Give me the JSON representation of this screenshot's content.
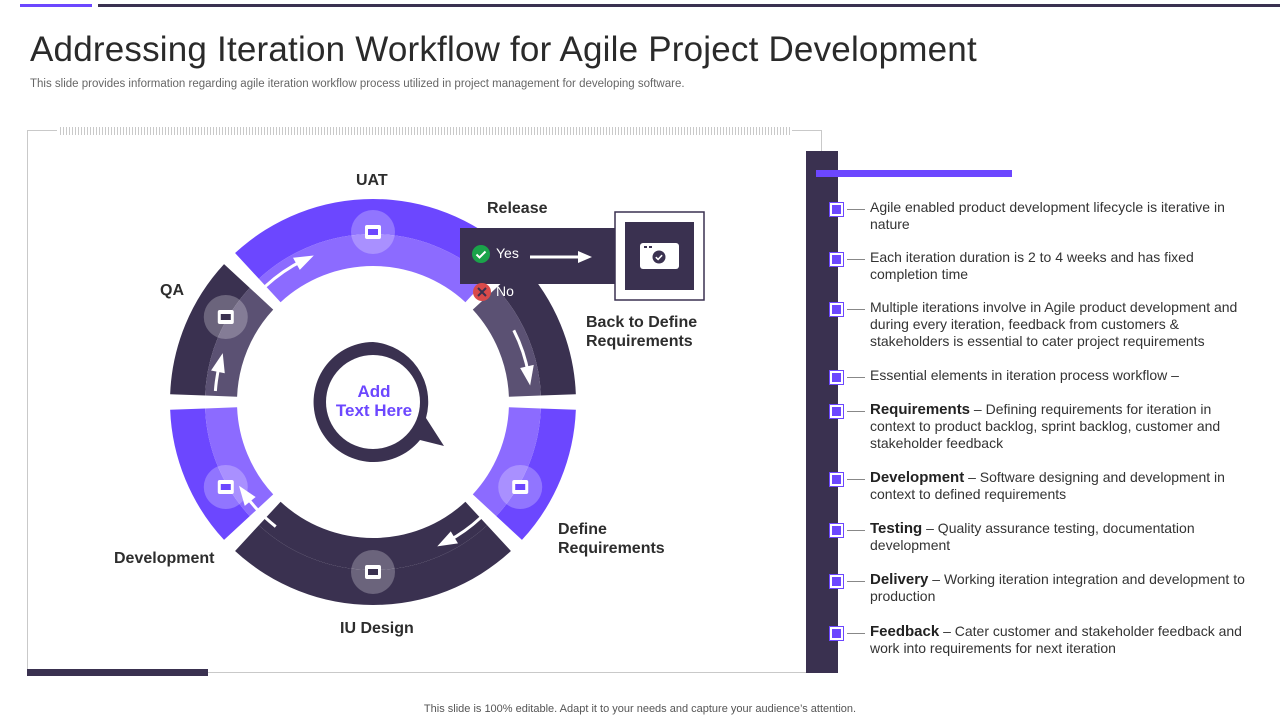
{
  "title": "Addressing Iteration Workflow for Agile Project Development",
  "subtitle": "This slide provides information regarding agile iteration workflow process utilized in project management for developing software.",
  "footer": "This slide is 100% editable. Adapt it to your needs and capture your audience’s attention.",
  "colors": {
    "accent": "#6c47ff",
    "dark": "#3a3150",
    "ring_mid": "#5b5173",
    "no": "#d94a4a",
    "yes": "#1aa34a"
  },
  "diagram": {
    "stages": {
      "uat": "UAT",
      "release": "Release",
      "qa": "QA",
      "development": "Development",
      "iu_design": "IU Design",
      "define_requirements": [
        "Define",
        "Requirements"
      ],
      "back_to_define": [
        "Back to Define",
        "Requirements"
      ]
    },
    "decision": {
      "yes": "Yes",
      "no": "No"
    },
    "center_text": [
      "Add",
      "Text Here"
    ],
    "icons": [
      "thumbs-up-icon",
      "code-window-icon",
      "clipboard-search-icon",
      "monitor-icon",
      "code-window-search-icon",
      "camera-icon"
    ]
  },
  "bullets": [
    {
      "text": "Agile enabled product development lifecycle is iterative in nature"
    },
    {
      "text": "Each iteration duration is 2 to 4 weeks and has fixed completion time"
    },
    {
      "text": "Multiple iterations involve in Agile product development and during every iteration, feedback from customers & stakeholders is essential to cater project requirements"
    },
    {
      "text": "Essential elements in iteration process workflow –"
    },
    {
      "bold": "Requirements",
      "text": " – Defining requirements for iteration in context to product backlog, sprint backlog, customer and stakeholder feedback"
    },
    {
      "bold": "Development",
      "text": " – Software designing and development in context to defined requirements"
    },
    {
      "bold": "Testing",
      "text": " – Quality assurance testing, documentation development"
    },
    {
      "bold": "Delivery",
      "text": " – Working iteration integration and development to production"
    },
    {
      "bold": "Feedback",
      "text": " – Cater customer and stakeholder feedback and work into requirements for next iteration"
    }
  ]
}
